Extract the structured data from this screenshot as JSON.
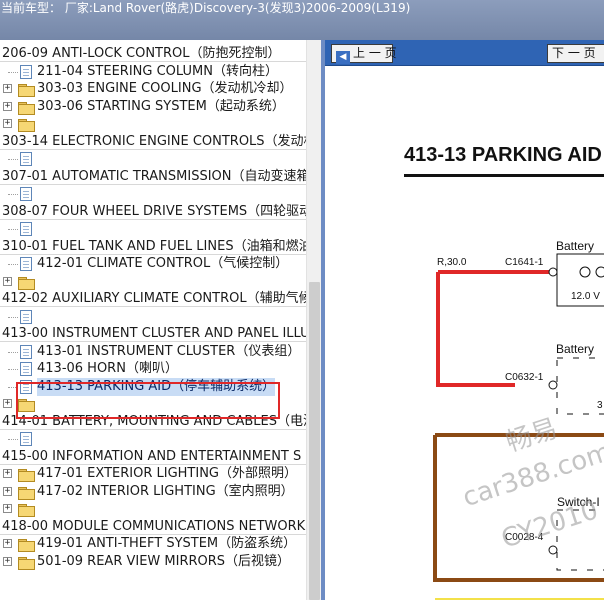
{
  "titlebar": {
    "text": "当前车型：   厂家:Land Rover(路虎)Discovery-3(发现3)2006-2009(L319)"
  },
  "tree": {
    "items": [
      {
        "label": "206-09 ANTI-LOCK CONTROL（防抱死控制）",
        "type": "folder",
        "level": 0,
        "icon": "none"
      },
      {
        "label": "211-04 STEERING COLUMN（转向柱）",
        "type": "doc",
        "level": 1,
        "icon": "doc-icon"
      },
      {
        "label": "303-03 ENGINE COOLING（发动机冷却）",
        "type": "doc",
        "level": 1,
        "icon": "folder-icon"
      },
      {
        "label": "303-06 STARTING SYSTEM（起动系统）",
        "type": "folder",
        "level": 1,
        "icon": "folder-icon"
      },
      {
        "label": "",
        "type": "folder",
        "level": 1,
        "icon": "folder-icon"
      },
      {
        "label": "303-14 ELECTRONIC ENGINE CONTROLS（发动机",
        "type": "folder",
        "level": 0,
        "icon": "none"
      },
      {
        "label": "",
        "type": "doc",
        "level": 1,
        "icon": "doc-icon"
      },
      {
        "label": "307-01 AUTOMATIC TRANSMISSION（自动变速箱",
        "type": "folder",
        "level": 0,
        "icon": "none"
      },
      {
        "label": "",
        "type": "doc",
        "level": 1,
        "icon": "doc-icon"
      },
      {
        "label": "308-07 FOUR WHEEL DRIVE SYSTEMS（四轮驱动",
        "type": "folder",
        "level": 0,
        "icon": "none"
      },
      {
        "label": "",
        "type": "doc",
        "level": 1,
        "icon": "doc-icon"
      },
      {
        "label": "310-01 FUEL TANK AND FUEL LINES（油箱和燃油",
        "type": "folder",
        "level": 0,
        "icon": "none"
      },
      {
        "label": "412-01 CLIMATE CONTROL（气候控制）",
        "type": "doc",
        "level": 1,
        "icon": "doc-icon"
      },
      {
        "label": "",
        "type": "folder",
        "level": 1,
        "icon": "folder-icon"
      },
      {
        "label": "412-02 AUXILIARY CLIMATE CONTROL（辅助气候",
        "type": "folder",
        "level": 0,
        "icon": "none"
      },
      {
        "label": "",
        "type": "doc",
        "level": 1,
        "icon": "doc-icon"
      },
      {
        "label": "413-00 INSTRUMENT CLUSTER AND PANEL ILLU",
        "type": "folder",
        "level": 0,
        "icon": "none"
      },
      {
        "label": "413-01 INSTRUMENT CLUSTER（仪表组）",
        "type": "doc",
        "level": 1,
        "icon": "doc-icon"
      },
      {
        "label": "413-06 HORN（喇叭）",
        "type": "doc",
        "level": 1,
        "icon": "doc-icon"
      },
      {
        "label": "413-13 PARKING AID（停车辅助系统）",
        "type": "doc",
        "level": 1,
        "icon": "doc-icon",
        "selected": true
      },
      {
        "label": "",
        "type": "folder",
        "level": 1,
        "icon": "folder-icon"
      },
      {
        "label": "414-01 BATTERY, MOUNTING AND CABLES（电池",
        "type": "folder",
        "level": 0,
        "icon": "none"
      },
      {
        "label": "",
        "type": "doc",
        "level": 1,
        "icon": "doc-icon"
      },
      {
        "label": "415-00 INFORMATION AND ENTERTAINMENT S",
        "type": "folder",
        "level": 0,
        "icon": "none"
      },
      {
        "label": "417-01 EXTERIOR LIGHTING（外部照明）",
        "type": "folder",
        "level": 1,
        "icon": "folder-icon"
      },
      {
        "label": "417-02 INTERIOR LIGHTING（室内照明）",
        "type": "folder",
        "level": 1,
        "icon": "folder-icon"
      },
      {
        "label": "",
        "type": "folder",
        "level": 1,
        "icon": "folder-icon"
      },
      {
        "label": "418-00 MODULE COMMUNICATIONS NETWORK",
        "type": "folder",
        "level": 0,
        "icon": "none"
      },
      {
        "label": "419-01 ANTI-THEFT SYSTEM（防盗系统）",
        "type": "folder",
        "level": 1,
        "icon": "folder-icon"
      },
      {
        "label": "501-09 REAR VIEW MIRRORS（后视镜）",
        "type": "folder",
        "level": 1,
        "icon": "folder-icon"
      }
    ]
  },
  "viewer": {
    "prev_label": "上 一 页",
    "next_label": "下 一 页",
    "page_heading": "413-13 PARKING AID",
    "diagram": {
      "wire_label": "R,30.0",
      "connector_1": "C1641-1",
      "connector_2": "C0632-1",
      "connector_3": "C0028-4",
      "battery_label_1": "Battery",
      "battery_label_2": "Battery",
      "voltage_label": "12.0 V",
      "switch_label": "Switch-I",
      "digit_label": "3"
    },
    "watermark": {
      "line1": "畅易",
      "line2": "car388.com",
      "line3": "CY2010"
    },
    "colors": {
      "accent_blue": "#2f64b4",
      "wire_red": "#e02828",
      "wire_brown": "#8b4a14"
    }
  }
}
